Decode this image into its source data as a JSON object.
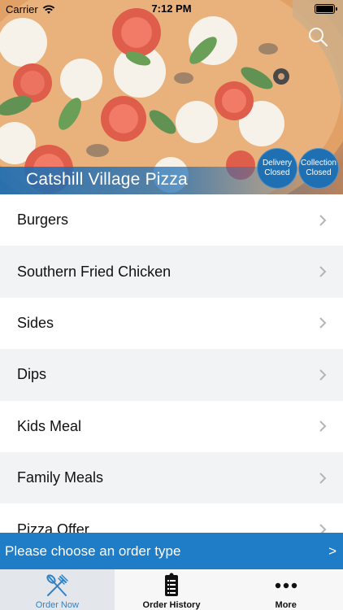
{
  "status_bar": {
    "carrier": "Carrier",
    "time": "7:12 PM"
  },
  "header": {
    "restaurant_name": "Catshill Village Pizza",
    "delivery_status": {
      "line1": "Delivery",
      "line2": "Closed"
    },
    "collection_status": {
      "line1": "Collection",
      "line2": "Closed"
    },
    "search_icon": "search-icon",
    "accent_color": "#1f6fb3"
  },
  "menu": {
    "items": [
      {
        "label": "Burgers"
      },
      {
        "label": "Southern Fried Chicken"
      },
      {
        "label": "Sides"
      },
      {
        "label": "Dips"
      },
      {
        "label": "Kids Meal"
      },
      {
        "label": "Family Meals"
      },
      {
        "label": "Pizza Offer"
      }
    ],
    "chevron_icon": "chevron-right-icon"
  },
  "order_bar": {
    "label": "Please choose an order type",
    "arrow": ">",
    "color": "#1f7dc7"
  },
  "tab_bar": {
    "tabs": [
      {
        "label": "Order Now",
        "icon": "utensils-icon",
        "active": true
      },
      {
        "label": "Order History",
        "icon": "receipt-icon",
        "active": false
      },
      {
        "label": "More",
        "icon": "more-dots-icon",
        "active": false
      }
    ],
    "active_color": "#2f82c9"
  }
}
